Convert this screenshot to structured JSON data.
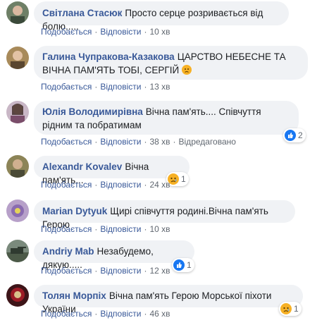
{
  "labels": {
    "like": "Подобається",
    "reply": "Відповісти"
  },
  "colors": {
    "link": "#385898",
    "bubble": "#f0f2f5",
    "like": "#1877f2",
    "sad": "#f7b125"
  },
  "comments": [
    {
      "author": "Світлана Стасюк",
      "text": "Просто серце розривається від болю.....",
      "time": "10 хв",
      "edited": ""
    },
    {
      "author": "Галина Чупракова-Казакова",
      "text": "ЦАРСТВО НЕБЕСНЕ ТА ВІЧНА ПАМ'ЯТЬ ТОБІ, СЕРГІЙ",
      "time": "13 хв",
      "edited": "",
      "emoji": "sad-emoji"
    },
    {
      "author": "Юлія Володимирівна",
      "text": "Вічна пам'ять.... Співчуття рідним та побратимам",
      "time": "38 хв",
      "edited": "Відредаговано",
      "reaction": {
        "icon": "like-icon",
        "count": "2"
      }
    },
    {
      "author": "Alexandr Kovalev",
      "text": "Вічна пам'ять...",
      "time": "24 хв",
      "edited": "",
      "reaction": {
        "icon": "sad-icon",
        "count": "1"
      }
    },
    {
      "author": "Marian Dytyuk",
      "text": "Щирі співчуття родині.Вічна пам'ять Герою",
      "time": "10 хв",
      "edited": ""
    },
    {
      "author": "Andriy Mab",
      "text": "Незабудемо, дякую.....",
      "time": "12 хв",
      "edited": "",
      "reaction": {
        "icon": "like-icon",
        "count": "1"
      }
    },
    {
      "author": "Толян Морпіх",
      "text": "Вічна пам'ять Герою Морської піхоти України",
      "time": "46 хв",
      "edited": "",
      "reaction": {
        "icon": "sad-icon",
        "count": "1"
      }
    }
  ]
}
